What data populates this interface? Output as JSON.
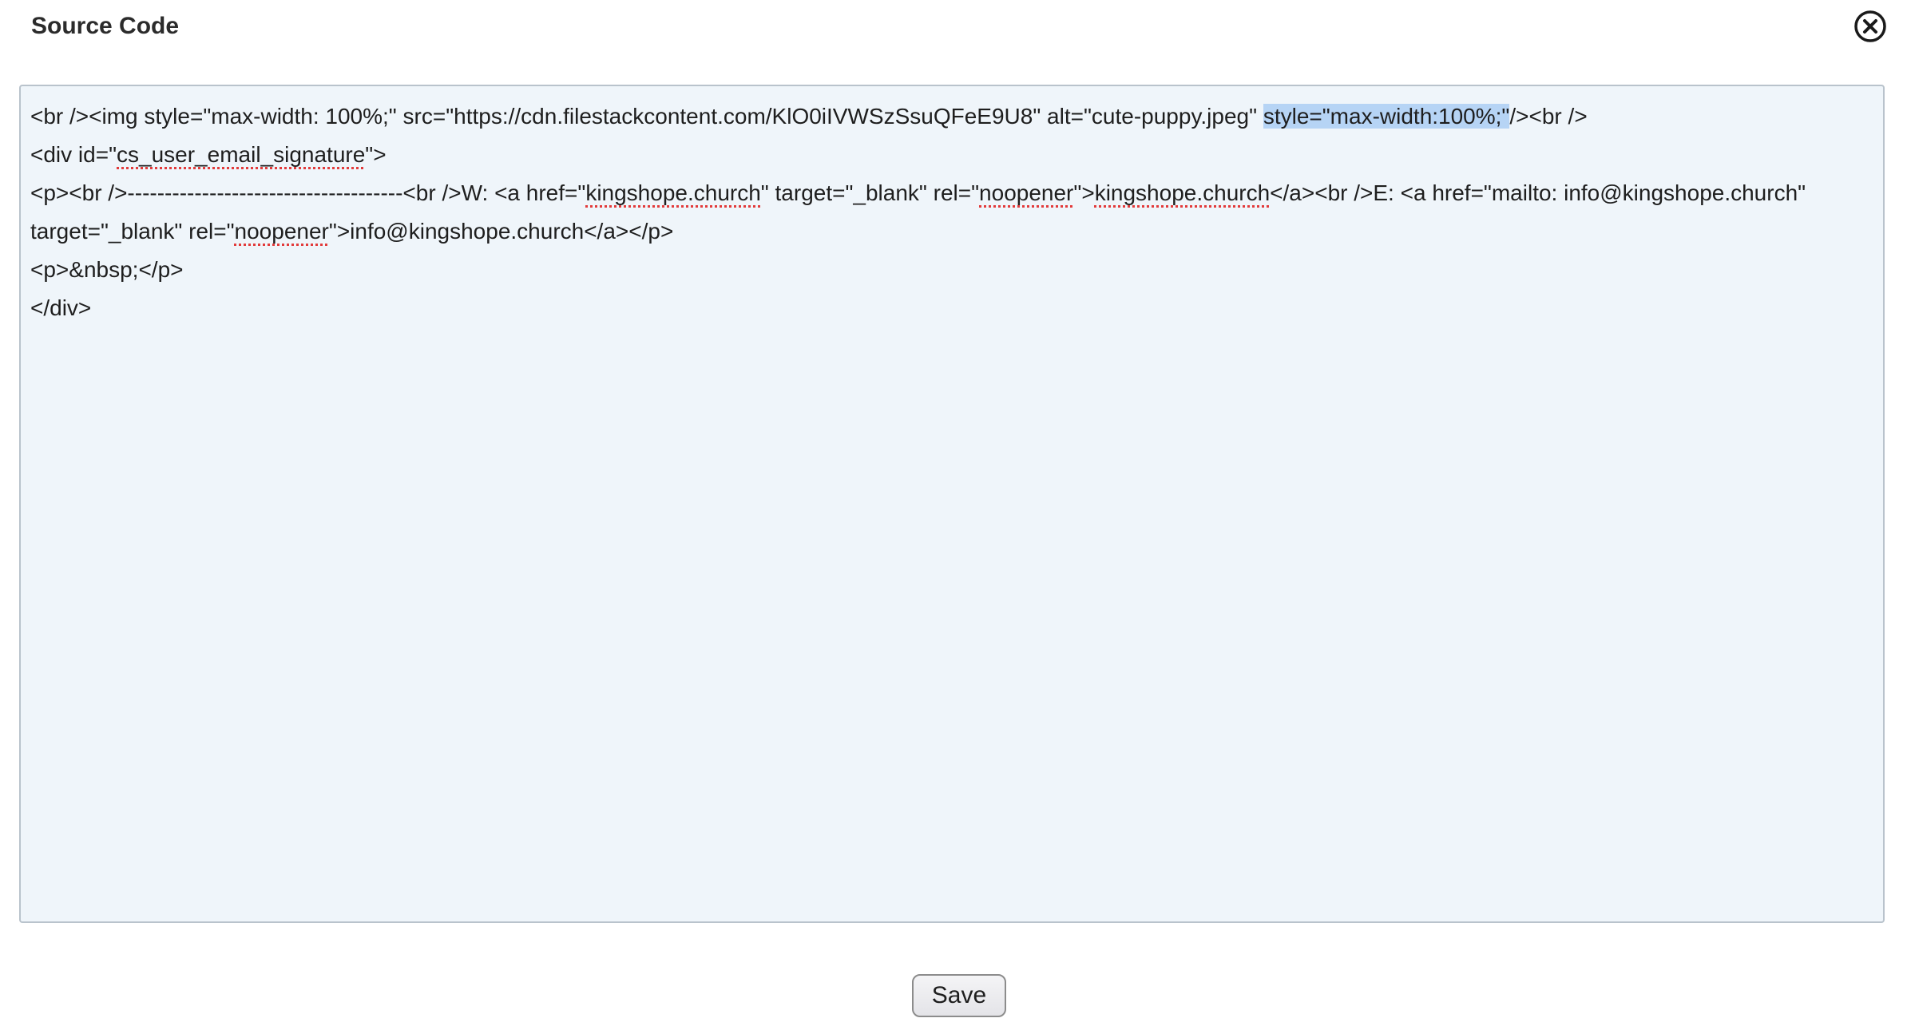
{
  "dialog": {
    "title": "Source Code",
    "close_icon": "close-circle-icon",
    "save_label": "Save"
  },
  "editor": {
    "line1": {
      "a": "<br /><img style=\"max-width: 100%;\" src=\"https://cdn.filestackcontent.com/KlO0iIVWSzSsuQFeE9U8\" alt=\"cute-puppy.jpeg\" ",
      "selected": "style=\"max-width:100%;\"",
      "b": "/><br />"
    },
    "line2": {
      "a": "<div id=\"",
      "misspelled": "cs_user_email_signature",
      "b": "\">"
    },
    "line3": {
      "a": "<p><br />-------------------------------------<br />W: <a href=\"",
      "m1": "kingshope.church",
      "b": "\" target=\"_blank\" rel=\"",
      "m2": "noopener",
      "c": "\">",
      "m3": "kingshope.church",
      "d": "</a><br />E: <a href=\"mailto: info@kingshope.church\""
    },
    "line4": {
      "a": "target=\"_blank\" rel=\"",
      "m1": "noopener",
      "b": "\">info@kingshope.church</a></p>"
    },
    "line5": "<p>&nbsp;</p>",
    "line6": "</div>",
    "selection_color": "#b6d4f5",
    "background_color": "#eff5fa"
  }
}
